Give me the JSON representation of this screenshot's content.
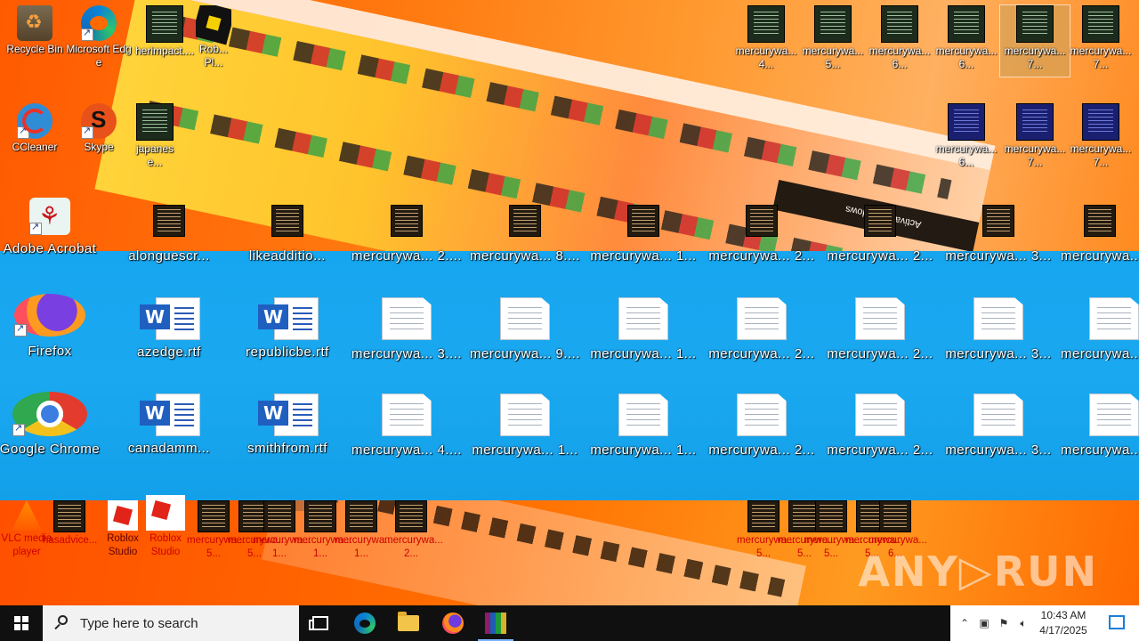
{
  "desktop": {
    "top_icons": [
      {
        "label": "Recycle Bin",
        "icon": "recycle-bin-icon"
      },
      {
        "label": "Microsoft Edge",
        "icon": "edge-icon"
      },
      {
        "label": "herimpact....",
        "icon": "document-icon"
      },
      {
        "label": "Rob... Pl...",
        "icon": "roblox-icon"
      },
      {
        "label": "mercurywa... 4...",
        "icon": "document-icon"
      },
      {
        "label": "mercurywa... 5...",
        "icon": "document-icon"
      },
      {
        "label": "mercurywa... 6...",
        "icon": "document-icon"
      },
      {
        "label": "mercurywa... 6...",
        "icon": "document-icon"
      },
      {
        "label": "mercurywa... 7...",
        "icon": "document-icon"
      },
      {
        "label": "mercurywa... 7...",
        "icon": "document-icon"
      }
    ],
    "second_icons": [
      {
        "label": "CCleaner",
        "icon": "ccleaner-icon"
      },
      {
        "label": "Skype",
        "icon": "skype-icon"
      },
      {
        "label": "japanese...",
        "icon": "document-icon"
      },
      {
        "label": "mercurywa... 6...",
        "icon": "document-icon"
      },
      {
        "label": "mercurywa... 7...",
        "icon": "document-icon"
      },
      {
        "label": "mercurywa... 7...",
        "icon": "document-icon"
      }
    ],
    "third_row": [
      {
        "label": "Adobe Acrobat",
        "icon": "acrobat-icon"
      },
      {
        "label": "alonguescr...",
        "icon": "document-icon"
      },
      {
        "label": "likeadditio...",
        "icon": "winrar-icon"
      },
      {
        "label": "mercurywa... 2....",
        "icon": "document-icon"
      },
      {
        "label": "mercurywa... 8....",
        "icon": "document-icon"
      },
      {
        "label": "mercurywa... 1...",
        "icon": "document-icon"
      },
      {
        "label": "mercurywa... 2...",
        "icon": "document-icon"
      },
      {
        "label": "mercurywa... 2...",
        "icon": "document-icon"
      },
      {
        "label": "mercurywa... 3...",
        "icon": "document-icon"
      },
      {
        "label": "mercurywa...",
        "icon": "document-icon"
      }
    ],
    "fourth_row": [
      {
        "label": "Firefox",
        "icon": "firefox-icon"
      },
      {
        "label": "azedge.rtf",
        "icon": "word-document-icon"
      },
      {
        "label": "republicbe.rtf",
        "icon": "word-document-icon"
      },
      {
        "label": "mercurywa... 3....",
        "icon": "text-file-icon"
      },
      {
        "label": "mercurywa... 9....",
        "icon": "text-file-icon"
      },
      {
        "label": "mercurywa... 1...",
        "icon": "text-file-icon"
      },
      {
        "label": "mercurywa... 2...",
        "icon": "text-file-icon"
      },
      {
        "label": "mercurywa... 2...",
        "icon": "text-file-icon"
      },
      {
        "label": "mercurywa... 3...",
        "icon": "text-file-icon"
      },
      {
        "label": "mercurywa...",
        "icon": "text-file-icon"
      }
    ],
    "fifth_row": [
      {
        "label": "Google Chrome",
        "icon": "chrome-icon"
      },
      {
        "label": "canadamm...",
        "icon": "word-document-icon"
      },
      {
        "label": "smithfrom.rtf",
        "icon": "word-document-icon"
      },
      {
        "label": "mercurywa... 4....",
        "icon": "text-file-icon"
      },
      {
        "label": "mercurywa... 1...",
        "icon": "text-file-icon"
      },
      {
        "label": "mercurywa... 1...",
        "icon": "text-file-icon"
      },
      {
        "label": "mercurywa... 2...",
        "icon": "text-file-icon"
      },
      {
        "label": "mercurywa... 2...",
        "icon": "text-file-icon"
      },
      {
        "label": "mercurywa... 3...",
        "icon": "text-file-icon"
      },
      {
        "label": "mercurywa...",
        "icon": "text-file-icon"
      }
    ],
    "bottom_strip": [
      {
        "label": "VLC media player",
        "icon": "vlc-icon"
      },
      {
        "label": "hasadvice...",
        "icon": "document-icon"
      },
      {
        "label": "Roblox Studio",
        "icon": "roblox-studio-icon"
      },
      {
        "label": "Roblox Studio",
        "icon": "roblox-studio-icon"
      },
      {
        "label": "mercurywa... 5...",
        "icon": "document-icon"
      },
      {
        "label": "mercurywa... 5...",
        "icon": "document-icon"
      },
      {
        "label": "mercurywa... 1...",
        "icon": "document-icon"
      },
      {
        "label": "mercurywa... 1...",
        "icon": "document-icon"
      },
      {
        "label": "mercurywa... 1...",
        "icon": "document-icon"
      },
      {
        "label": "mercurywa... 2...",
        "icon": "document-icon"
      }
    ],
    "bottom_right": [
      {
        "label": "mercurywa... 5...",
        "icon": "document-icon"
      },
      {
        "label": "mercurywa... 5...",
        "icon": "document-icon"
      },
      {
        "label": "mercurywa... 5...",
        "icon": "document-icon"
      },
      {
        "label": "mercurywa... 5...",
        "icon": "document-icon"
      },
      {
        "label": "mercurywa... 6...",
        "icon": "document-icon"
      }
    ],
    "glitch_text": "Activate Windows"
  },
  "watermark": {
    "text_left": "ANY",
    "text_right": "RUN"
  },
  "taskbar": {
    "search_placeholder": "Type here to search",
    "clock_time": "10:43 AM",
    "clock_date": "4/17/2025"
  },
  "colors": {
    "desktop_blue": "#16a6ef",
    "desktop_orange": "#ff6a00",
    "taskbar": "#101010"
  }
}
